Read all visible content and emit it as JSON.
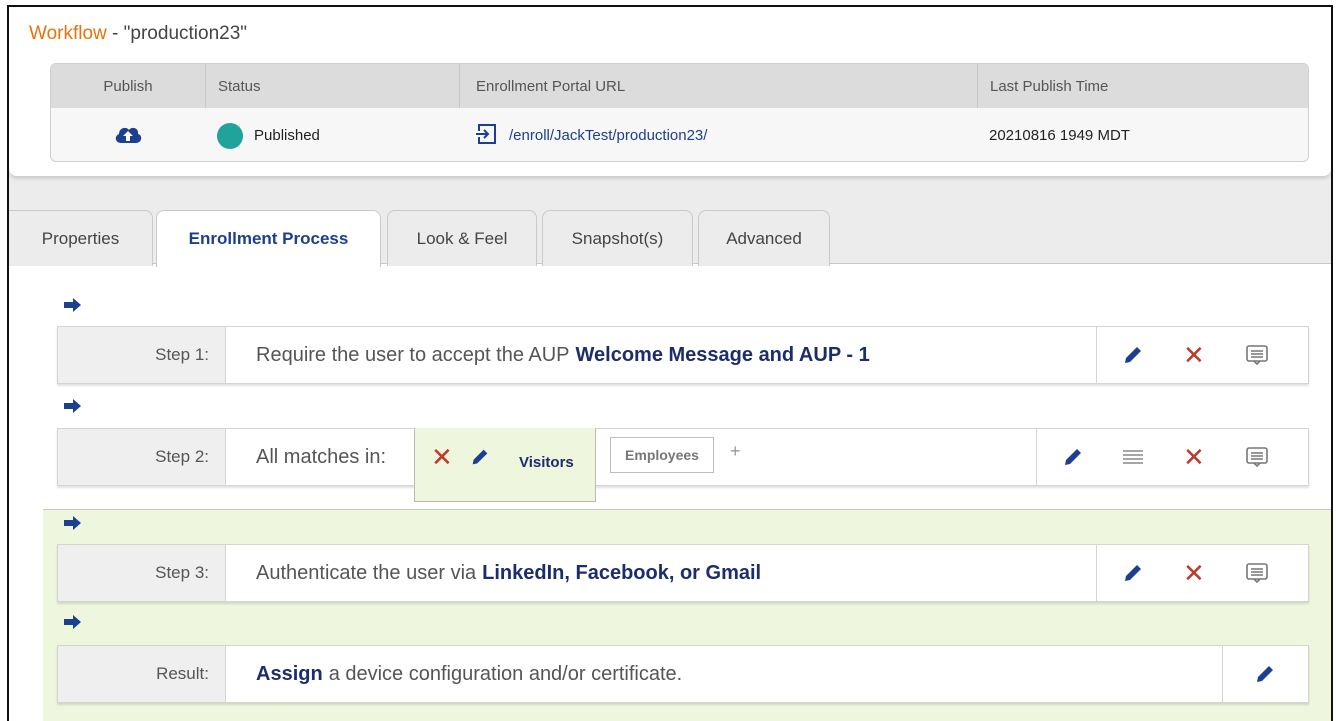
{
  "workflow": {
    "title_prefix": "Workflow",
    "title_separator": " - ",
    "title_name": "\"production23\""
  },
  "publish_table": {
    "headers": [
      "Publish",
      "Status",
      "Enrollment Portal URL",
      "Last Publish Time"
    ],
    "row": {
      "publish_icon": "cloud-upload-icon",
      "status": "Published",
      "status_color": "#1fa39b",
      "portal_url": "/enroll/JackTest/production23/",
      "last_publish_time": "20210816 1949 MDT"
    }
  },
  "tabs": [
    "Properties",
    "Enrollment Process",
    "Look & Feel",
    "Snapshot(s)",
    "Advanced"
  ],
  "active_tab": "Enrollment Process",
  "steps": {
    "step1": {
      "label": "Step 1:",
      "text": "Require the user to accept the AUP",
      "highlight": "Welcome Message and AUP - 1"
    },
    "step2": {
      "label": "Step 2:",
      "text": "All matches in:",
      "rule_tabs": [
        "Visitors",
        "Employees"
      ],
      "add_label": "+"
    },
    "step3": {
      "label": "Step 3:",
      "text": "Authenticate the user via",
      "highlight": "LinkedIn, Facebook, or Gmail"
    },
    "result": {
      "label": "Result:",
      "highlight": "Assign",
      "text": "a device configuration and/or certificate."
    }
  },
  "colors": {
    "accent_orange": "#e8720c",
    "link_blue": "#1d3f8f",
    "highlight_navy": "#1b2d6b",
    "delete_red": "#c0392b",
    "green_region": "#eef6dd"
  },
  "icons": {
    "edit": "pencil-icon",
    "delete": "close-icon",
    "notes": "message-icon",
    "reorder": "menu-icon",
    "arrow": "arrow-right-icon",
    "portal": "sign-in-icon"
  }
}
